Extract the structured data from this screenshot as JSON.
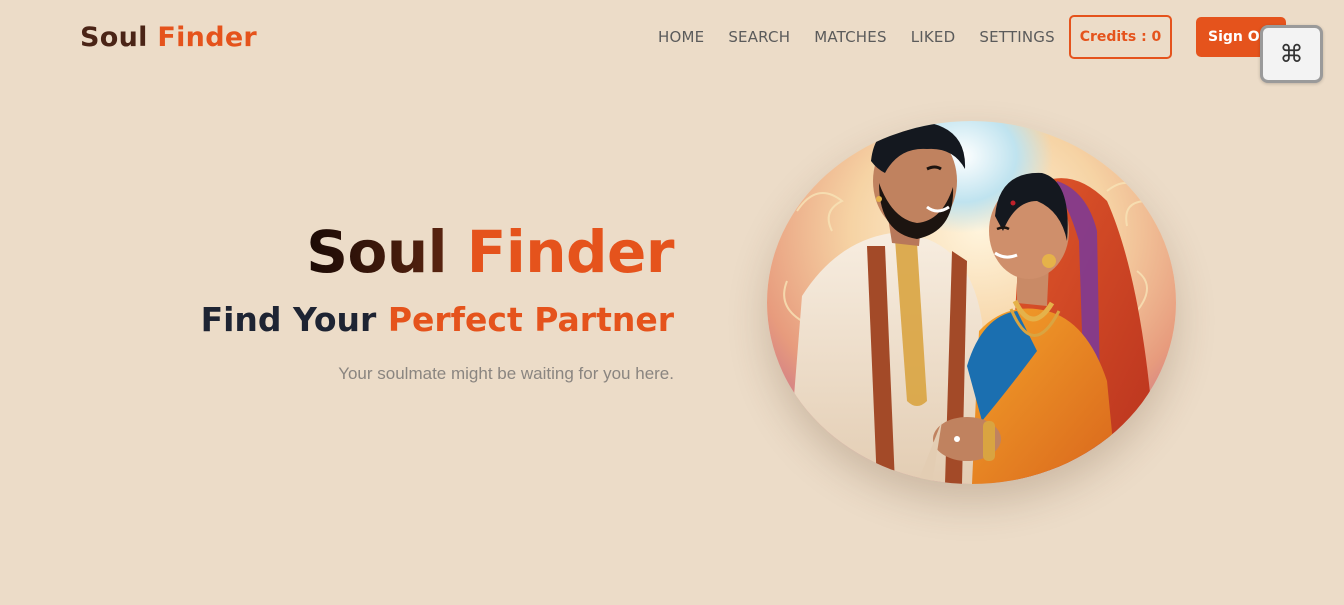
{
  "navbar": {
    "logo": {
      "word1": "Soul",
      "word2": "Finder"
    },
    "links": [
      "HOME",
      "SEARCH",
      "MATCHES",
      "LIKED",
      "SETTINGS"
    ],
    "credits_label": "Credits : 0",
    "signout_label": "Sign Out",
    "command_icon": "⌘"
  },
  "hero": {
    "title_word1": "Soul",
    "title_word2": "Finder",
    "subtitle_part1": "Find Your",
    "subtitle_part2": "Perfect Partner",
    "tagline": "Your soulmate might be waiting for you here.",
    "image": "couple-illustration"
  },
  "colors": {
    "background": "#ecdcc8",
    "accent": "#e5531c",
    "dark_brown": "#4a2416",
    "navy": "#1e2433"
  }
}
